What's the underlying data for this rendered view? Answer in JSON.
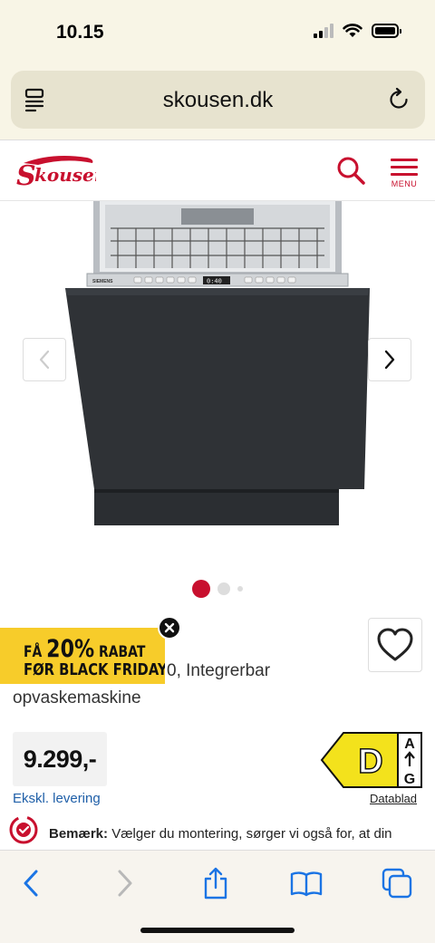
{
  "status_bar": {
    "time": "10.15"
  },
  "browser": {
    "url": "skousen.dk"
  },
  "site": {
    "logo_text": "Skousen",
    "menu_label": "MENU",
    "brand_color": "#c8102e"
  },
  "gallery": {
    "image_brand_text": "SIEMENS",
    "image_display_text": "0:40",
    "slide_count": 3,
    "active_slide": 1
  },
  "product": {
    "title_line1_visible": "0, Integrerbar",
    "title_line2": "opvaskemaskine",
    "price": "9.299,-",
    "delivery_note": "Ekskl. levering",
    "energy_class": "D",
    "energy_scale_top": "A",
    "energy_scale_bottom": "G",
    "datasheet_link": "Datablad"
  },
  "promo": {
    "prefix": "FÅ",
    "percent": "20%",
    "suffix": "RABAT",
    "line2": "FØR BLACK FRIDAY",
    "color": "#f7cc2a"
  },
  "notice": {
    "label": "Bemærk:",
    "text": "Vælger du montering, sørger vi også for, at din"
  },
  "toolbar": {
    "icons": [
      "back-icon",
      "forward-icon",
      "share-icon",
      "bookmarks-icon",
      "tabs-icon"
    ]
  }
}
